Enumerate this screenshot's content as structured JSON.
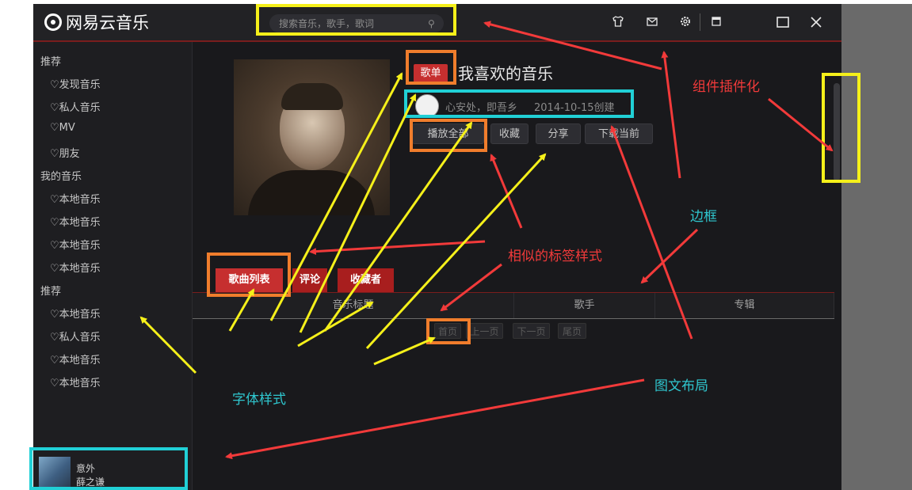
{
  "app": {
    "name": "网易云音乐"
  },
  "titlebar": {
    "search_placeholder": "搜索音乐，歌手，歌词",
    "icons": [
      "skin-icon",
      "mail-icon",
      "settings-icon",
      "mini-mode-icon",
      "maximize-icon",
      "close-icon"
    ]
  },
  "sidebar": {
    "sections": [
      {
        "title": "推荐",
        "items": [
          "♡发现音乐",
          "♡私人音乐",
          "♡MV",
          "♡朋友"
        ]
      },
      {
        "title": "我的音乐",
        "items": [
          "♡本地音乐",
          "♡本地音乐",
          "♡本地音乐",
          "♡本地音乐"
        ]
      },
      {
        "title": "推荐",
        "items": [
          "♡本地音乐",
          "♡私人音乐",
          "♡本地音乐",
          "♡本地音乐"
        ]
      }
    ]
  },
  "player": {
    "song": "意外",
    "artist": "薛之谦"
  },
  "playlist": {
    "badge": "歌单",
    "title": "我喜欢的音乐",
    "creator": "心安处，即吾乡",
    "created": "2014-10-15创建",
    "buttons": [
      "播放全部",
      "收藏",
      "分享",
      "下载当前"
    ]
  },
  "tabs": [
    "歌曲列表",
    "评论",
    "收藏者"
  ],
  "table": {
    "columns": [
      "音乐标题",
      "歌手",
      "专辑"
    ]
  },
  "pager": [
    "首页",
    "上一页",
    "下一页",
    "尾页"
  ],
  "annotations": {
    "component_plugin": "组件插件化",
    "border": "边框",
    "similar_tag_style": "相似的标签样式",
    "font_style": "字体样式",
    "image_text_layout": "图文布局"
  },
  "colors": {
    "window_bg": "#19191c",
    "accent_red": "#c62f2f",
    "highlight_yellow": "#f5f01a",
    "highlight_orange": "#f07d2c",
    "highlight_cyan": "#21d0d6",
    "arrow_red": "#f23a3a"
  }
}
